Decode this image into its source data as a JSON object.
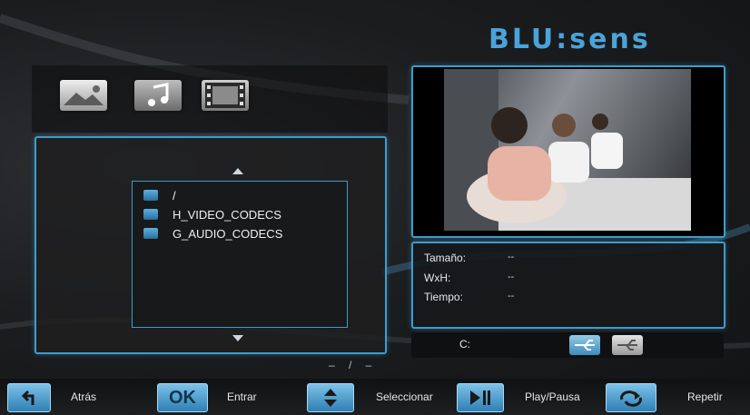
{
  "brand": {
    "logo_text": "BLU:sens",
    "accent_color": "#3e9ccc"
  },
  "media_tabs": [
    {
      "name": "photo-icon"
    },
    {
      "name": "music-icon"
    },
    {
      "name": "video-icon"
    }
  ],
  "browser": {
    "items": [
      {
        "label": "/",
        "icon": "folder-icon"
      },
      {
        "label": "H_VIDEO_CODECS",
        "icon": "folder-icon"
      },
      {
        "label": "G_AUDIO_CODECS",
        "icon": "folder-icon"
      }
    ],
    "pager": "– / –"
  },
  "info": {
    "size_label": "Tamaño:",
    "size_value": "--",
    "dims_label": "WxH:",
    "dims_value": "--",
    "time_label": "Tiempo:",
    "time_value": "--"
  },
  "device": {
    "drive_label": "C:",
    "usb_icons": [
      "usb-icon-active",
      "usb-icon-inactive"
    ]
  },
  "bottom_bar": {
    "back_label": "Atrás",
    "ok_icon_text": "OK",
    "enter_label": "Entrar",
    "select_label": "Seleccionar",
    "play_label": "Play/Pausa",
    "repeat_label": "Repetir"
  }
}
